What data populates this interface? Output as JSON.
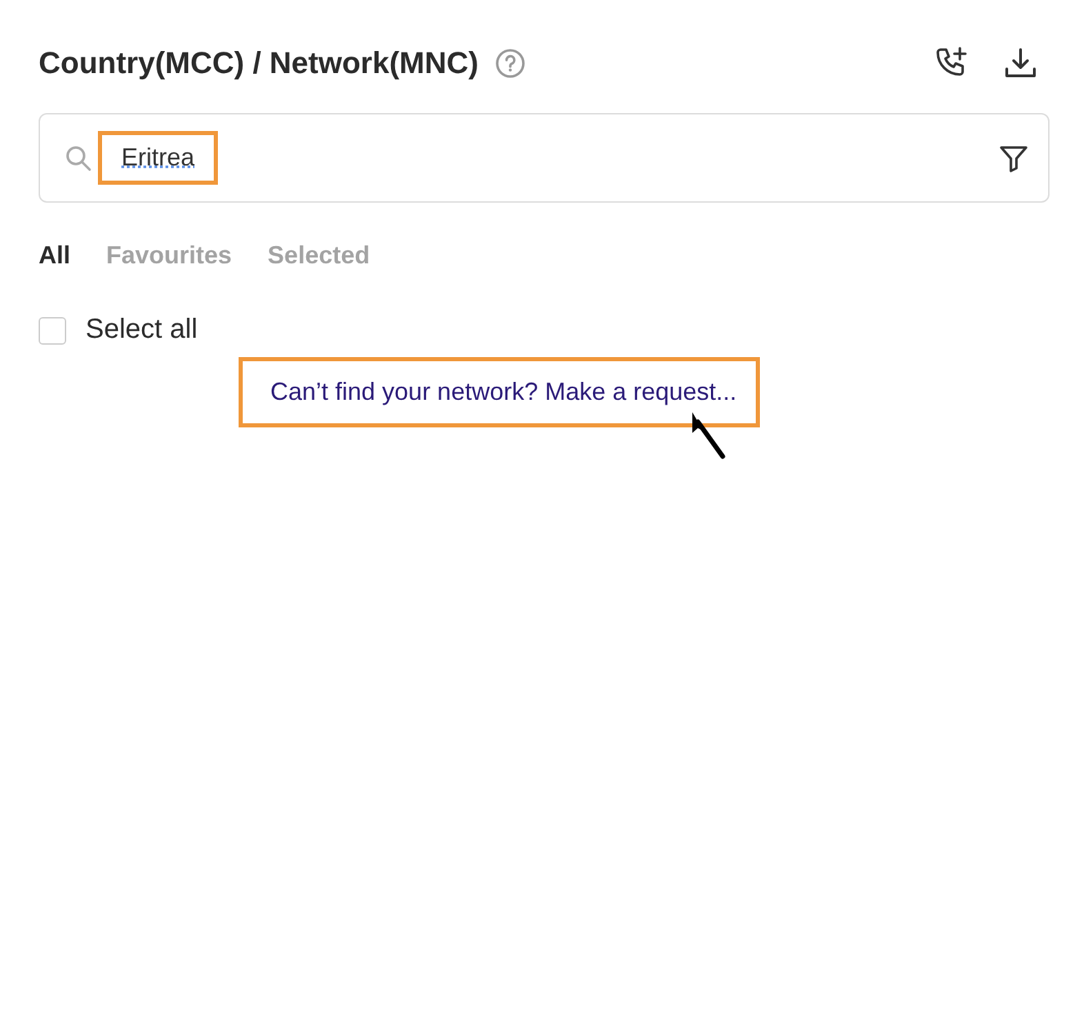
{
  "header": {
    "title": "Country(MCC) / Network(MNC)"
  },
  "search": {
    "value": "Eritrea",
    "highlighted": true
  },
  "tabs": [
    {
      "label": "All",
      "selected": true
    },
    {
      "label": "Favourites",
      "selected": false
    },
    {
      "label": "Selected",
      "selected": false
    }
  ],
  "select_all": {
    "label": "Select all",
    "checked": false
  },
  "request_link": {
    "text": "Can’t find your network? Make a request...",
    "highlighted": true
  }
}
